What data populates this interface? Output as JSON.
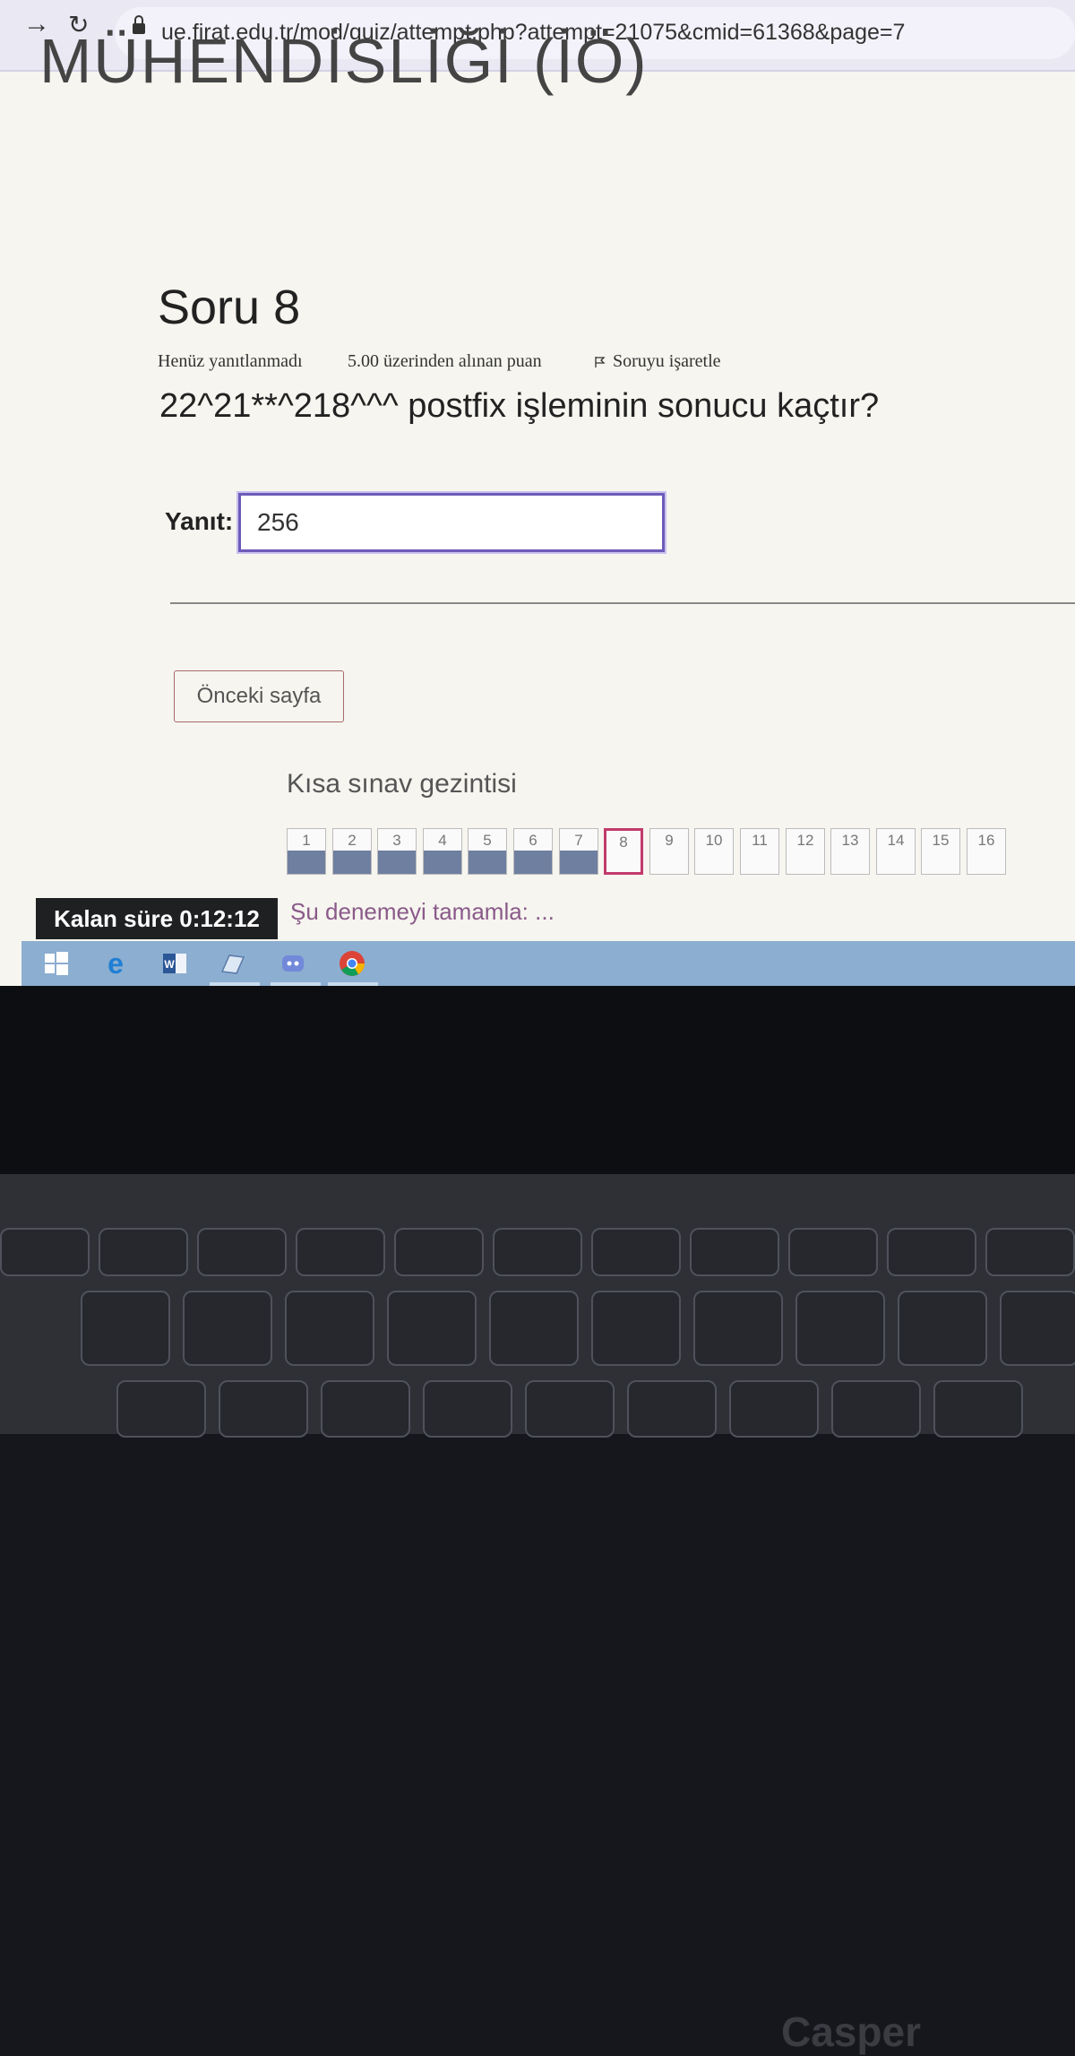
{
  "browser": {
    "url": "ue.firat.edu.tr/mod/quiz/attempt.php?attempt=21075&cmid=61368&page=7"
  },
  "page": {
    "course_title_partial": "MÜHENDİSLİĞİ (İÖ)"
  },
  "question": {
    "heading": "Soru 8",
    "status": "Henüz yanıtlanmadı",
    "marks": "5.00 üzerinden alınan puan",
    "flag_label": "Soruyu işaretle",
    "text": "22^21**^218^^^ postfix işleminin sonucu kaçtır?",
    "answer_label": "Yanıt:",
    "answer_value": "256"
  },
  "navigation": {
    "prev_button": "Önceki sayfa",
    "title": "Kısa sınav gezintisi",
    "items": [
      {
        "label": "1",
        "state": "answered"
      },
      {
        "label": "2",
        "state": "answered"
      },
      {
        "label": "3",
        "state": "answered"
      },
      {
        "label": "4",
        "state": "answered"
      },
      {
        "label": "5",
        "state": "answered"
      },
      {
        "label": "6",
        "state": "answered"
      },
      {
        "label": "7",
        "state": "answered"
      },
      {
        "label": "8",
        "state": "current"
      },
      {
        "label": "9",
        "state": "unanswered"
      },
      {
        "label": "10",
        "state": "unanswered"
      },
      {
        "label": "11",
        "state": "unanswered"
      },
      {
        "label": "12",
        "state": "unanswered"
      },
      {
        "label": "13",
        "state": "unanswered"
      },
      {
        "label": "14",
        "state": "unanswered"
      },
      {
        "label": "15",
        "state": "unanswered"
      },
      {
        "label": "16",
        "state": "unanswered"
      }
    ],
    "finish_link": "Şu denemeyi tamamla: ..."
  },
  "timer": {
    "label": "Kalan süre ",
    "value": "0:12:12"
  },
  "taskbar": {
    "icons": [
      "windows-start-icon",
      "edge-icon",
      "word-icon",
      "notepad-icon",
      "discord-icon",
      "chrome-icon"
    ]
  },
  "hardware": {
    "brand": "Casper"
  },
  "colors": {
    "answered_fill": "#6f7fa0",
    "current_border": "#c23a6c",
    "input_border": "#6d5bb8",
    "taskbar": "#8caed0"
  }
}
